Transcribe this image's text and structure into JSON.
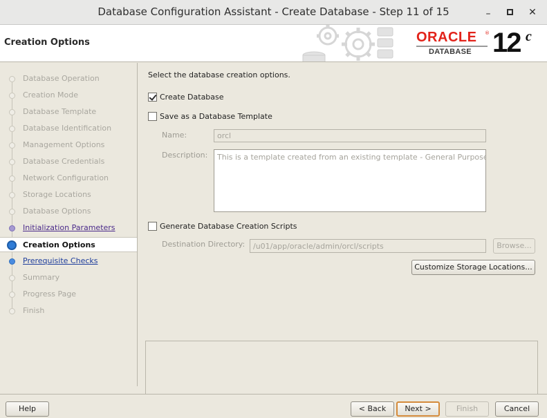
{
  "window": {
    "title": "Database Configuration Assistant - Create Database - Step 11 of 15",
    "controls": {
      "minimize": "–",
      "close": "✕"
    }
  },
  "banner": {
    "page_title": "Creation Options",
    "logo_word": "ORACLE",
    "logo_reg": "®",
    "logo_sub": "DATABASE",
    "version": "12",
    "version_suffix": "c"
  },
  "nav": {
    "items": [
      {
        "label": "Database Operation",
        "state": "disabled"
      },
      {
        "label": "Creation Mode",
        "state": "disabled"
      },
      {
        "label": "Database Template",
        "state": "disabled"
      },
      {
        "label": "Database Identification",
        "state": "disabled"
      },
      {
        "label": "Management Options",
        "state": "disabled"
      },
      {
        "label": "Database Credentials",
        "state": "disabled"
      },
      {
        "label": "Network Configuration",
        "state": "disabled"
      },
      {
        "label": "Storage Locations",
        "state": "disabled"
      },
      {
        "label": "Database Options",
        "state": "disabled"
      },
      {
        "label": "Initialization Parameters",
        "state": "visited"
      },
      {
        "label": "Creation Options",
        "state": "current"
      },
      {
        "label": "Prerequisite Checks",
        "state": "next"
      },
      {
        "label": "Summary",
        "state": "disabled"
      },
      {
        "label": "Progress Page",
        "state": "disabled"
      },
      {
        "label": "Finish",
        "state": "disabled"
      }
    ]
  },
  "content": {
    "instruction": "Select the database creation options.",
    "create_database": {
      "label": "Create Database",
      "checked": true
    },
    "save_template": {
      "label": "Save as a Database Template",
      "checked": false
    },
    "name_label": "Name:",
    "name_value": "orcl",
    "description_label": "Description:",
    "description_value": "This is a template created from an existing template - General Purpose.",
    "generate_scripts": {
      "label": "Generate Database Creation Scripts",
      "checked": false
    },
    "destination_label": "Destination Directory:",
    "destination_value": "/u01/app/oracle/admin/orcl/scripts",
    "browse_label": "Browse...",
    "customize_label": "Customize Storage Locations..."
  },
  "footer": {
    "help": "Help",
    "back": "< Back",
    "next": "Next >",
    "finish": "Finish",
    "cancel": "Cancel"
  }
}
